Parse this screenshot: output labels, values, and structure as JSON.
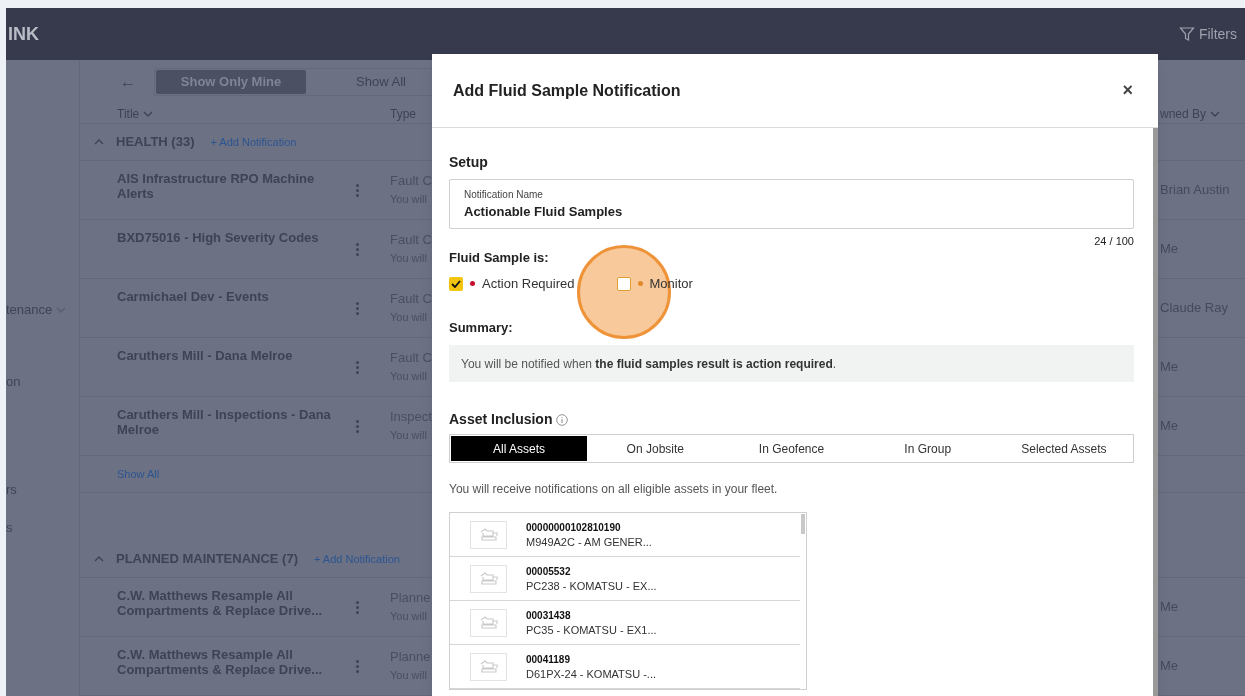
{
  "header": {
    "logo": "INK",
    "filters": "Filters"
  },
  "sidebar": {
    "items": [
      {
        "label": "tenance",
        "expandable": true
      },
      {
        "label": "on",
        "expandable": false
      },
      {
        "label": "rs",
        "expandable": false
      },
      {
        "label": "s",
        "expandable": false
      }
    ]
  },
  "toolbar": {
    "back": "←",
    "toggle": [
      {
        "label": "Show Only Mine",
        "selected": true
      },
      {
        "label": "Show All",
        "selected": false
      }
    ]
  },
  "table": {
    "columns": [
      "Title",
      "Type",
      "wned By"
    ],
    "sections": [
      {
        "title": "HEALTH (33)",
        "add": "+ Add Notification",
        "expanded": true,
        "rows": [
          {
            "title": "AIS Infrastructure RPO Machine Alerts",
            "type": "Fault C",
            "sub": "You will",
            "owner": "Brian Austin"
          },
          {
            "title": "BXD75016 - High Severity Codes",
            "type": "Fault C",
            "sub": "You will",
            "owner": "Me"
          },
          {
            "title": "Carmichael Dev - Events",
            "type": "Fault C",
            "sub": "You will",
            "owner": "Claude Ray"
          },
          {
            "title": "Caruthers Mill - Dana Melroe",
            "type": "Fault C",
            "sub": "You will",
            "owner": "Me"
          },
          {
            "title": "Caruthers Mill - Inspections - Dana Melroe",
            "type": "Inspect",
            "sub": "You will",
            "owner": "Me"
          }
        ],
        "show_all": "Show All"
      },
      {
        "title": "PLANNED MAINTENANCE (7)",
        "add": "+ Add Notification",
        "expanded": true,
        "rows": [
          {
            "title": "C.W. Matthews Resample All Compartments & Replace Drive...",
            "type": "Planne",
            "sub": "You will",
            "owner": "Me"
          },
          {
            "title": "C.W. Matthews Resample All Compartments & Replace Drive...",
            "type": "Planne",
            "sub": "You will",
            "owner": "Me"
          }
        ]
      }
    ]
  },
  "modal": {
    "title": "Add Fluid Sample Notification",
    "close": "×",
    "setup_heading": "Setup",
    "name_field": {
      "label": "Notification Name",
      "value": "Actionable Fluid Samples",
      "counter": "24 / 100"
    },
    "fluid_heading": "Fluid Sample is:",
    "options": [
      {
        "label": "Action Required",
        "checked": true,
        "color": "#c8102e"
      },
      {
        "label": "Monitor",
        "checked": false,
        "color": "#e0892a"
      }
    ],
    "summary_heading": "Summary:",
    "summary": "You will be notified when **the fluid samples result is action required**.",
    "asset_heading": "Asset Inclusion",
    "asset_tabs": [
      {
        "label": "All Assets",
        "selected": true
      },
      {
        "label": "On Jobsite",
        "selected": false
      },
      {
        "label": "In Geofence",
        "selected": false
      },
      {
        "label": "In Group",
        "selected": false
      },
      {
        "label": "Selected Assets",
        "selected": false
      }
    ],
    "asset_note": "You will receive notifications on all eligible assets in your fleet.",
    "assets": [
      {
        "id": "00000000102810190",
        "desc": "M949A2C - AM GENER..."
      },
      {
        "id": "00005532",
        "desc": "PC238 - KOMATSU - EX..."
      },
      {
        "id": "00031438",
        "desc": "PC35 - KOMATSU - EX1..."
      },
      {
        "id": "00041189",
        "desc": "D61PX-24 - KOMATSU -..."
      }
    ]
  }
}
